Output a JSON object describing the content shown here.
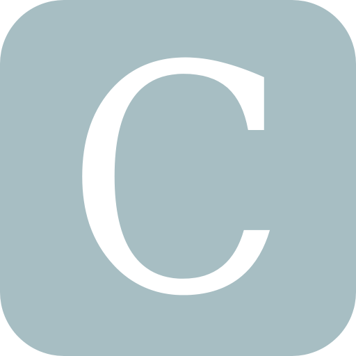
{
  "icon": {
    "letter": "C",
    "background_color": "#a7bec3",
    "letter_color": "#ffffff"
  }
}
